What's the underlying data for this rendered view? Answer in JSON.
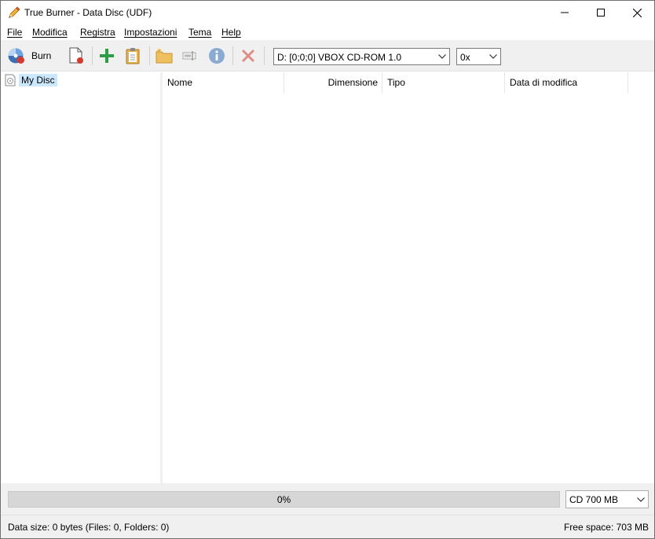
{
  "window": {
    "title": "True Burner - Data Disc (UDF)"
  },
  "menu": {
    "items": [
      {
        "mnemonic": "F",
        "rest": "ile"
      },
      {
        "mnemonic": "M",
        "rest": "odifica"
      },
      {
        "mnemonic": "R",
        "rest": "egistra"
      },
      {
        "mnemonic": "I",
        "rest": "mpostazioni"
      },
      {
        "mnemonic": "T",
        "rest": "ema"
      },
      {
        "mnemonic": "H",
        "rest": "elp"
      }
    ]
  },
  "toolbar": {
    "burn_label": "Burn",
    "drive": "D:  [0;0;0] VBOX CD-ROM 1.0",
    "speed": "0x",
    "icons": [
      "burn-disc-icon",
      "new-document-icon",
      "add-icon",
      "paste-icon",
      "new-folder-icon",
      "rename-icon",
      "info-icon",
      "delete-icon"
    ]
  },
  "tree": {
    "root_label": "My Disc"
  },
  "list": {
    "columns": [
      "Nome",
      "Dimensione",
      "Tipo",
      "Data di modifica"
    ]
  },
  "bottom": {
    "progress_text": "0%",
    "progress_fraction": 0,
    "capacity": "CD 700 MB",
    "status_left": "Data size: 0 bytes (Files: 0, Folders: 0)",
    "status_right": "Free space: 703 MB"
  },
  "colors": {
    "toolbar_bg": "#f0f0f0",
    "selection": "#cce8ff",
    "progress_bg": "#d6d6d6",
    "add_green": "#2e9e45",
    "delete_red": "#e0504a",
    "info_blue": "#7a9cc6"
  }
}
